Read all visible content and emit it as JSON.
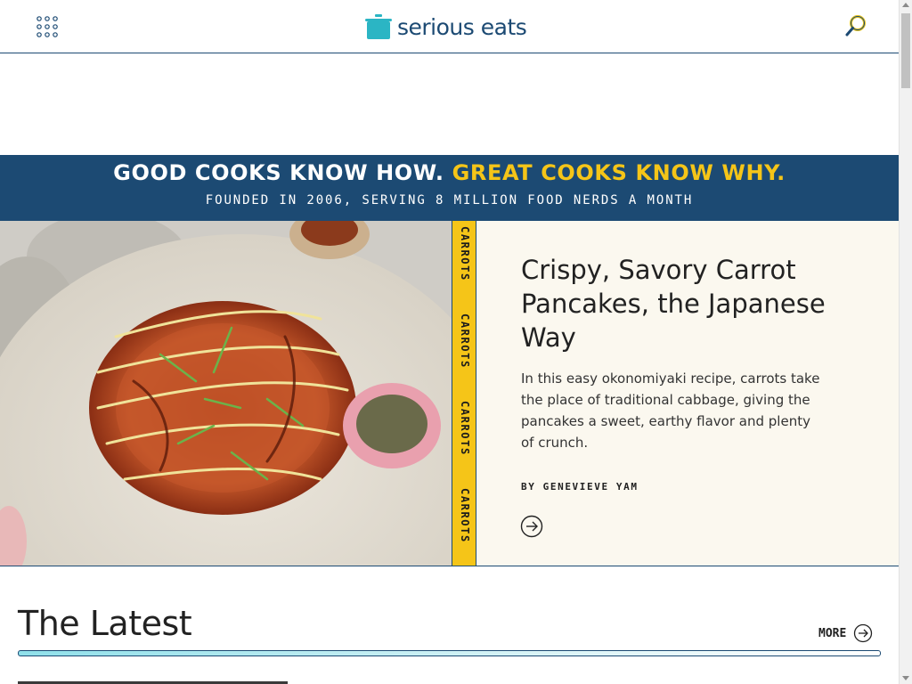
{
  "header": {
    "logo_text": "serious eats",
    "icons": {
      "menu": "grid-menu-icon",
      "search": "search-icon",
      "logo": "pot-icon"
    }
  },
  "banner": {
    "line1_a": "GOOD COOKS KNOW HOW.",
    "line1_b": "GREAT COOKS KNOW WHY.",
    "line2": "FOUNDED IN 2006, SERVING 8 MILLION FOOD NERDS A MONTH"
  },
  "hero": {
    "tag": "CARROTS",
    "title": "Crispy, Savory Carrot Pancakes, the Japanese Way",
    "description": "In this easy okonomiyaki recipe, carrots take the place of traditional cabbage, giving the pancakes a sweet, earthy flavor and plenty of crunch.",
    "author": "BY GENEVIEVE YAM"
  },
  "latest": {
    "title": "The Latest",
    "more_label": "MORE"
  },
  "colors": {
    "brand_navy": "#1c4a73",
    "brand_yellow": "#f5c518",
    "logo_teal": "#2bb5c4",
    "hero_bg": "#fbf8ef"
  }
}
